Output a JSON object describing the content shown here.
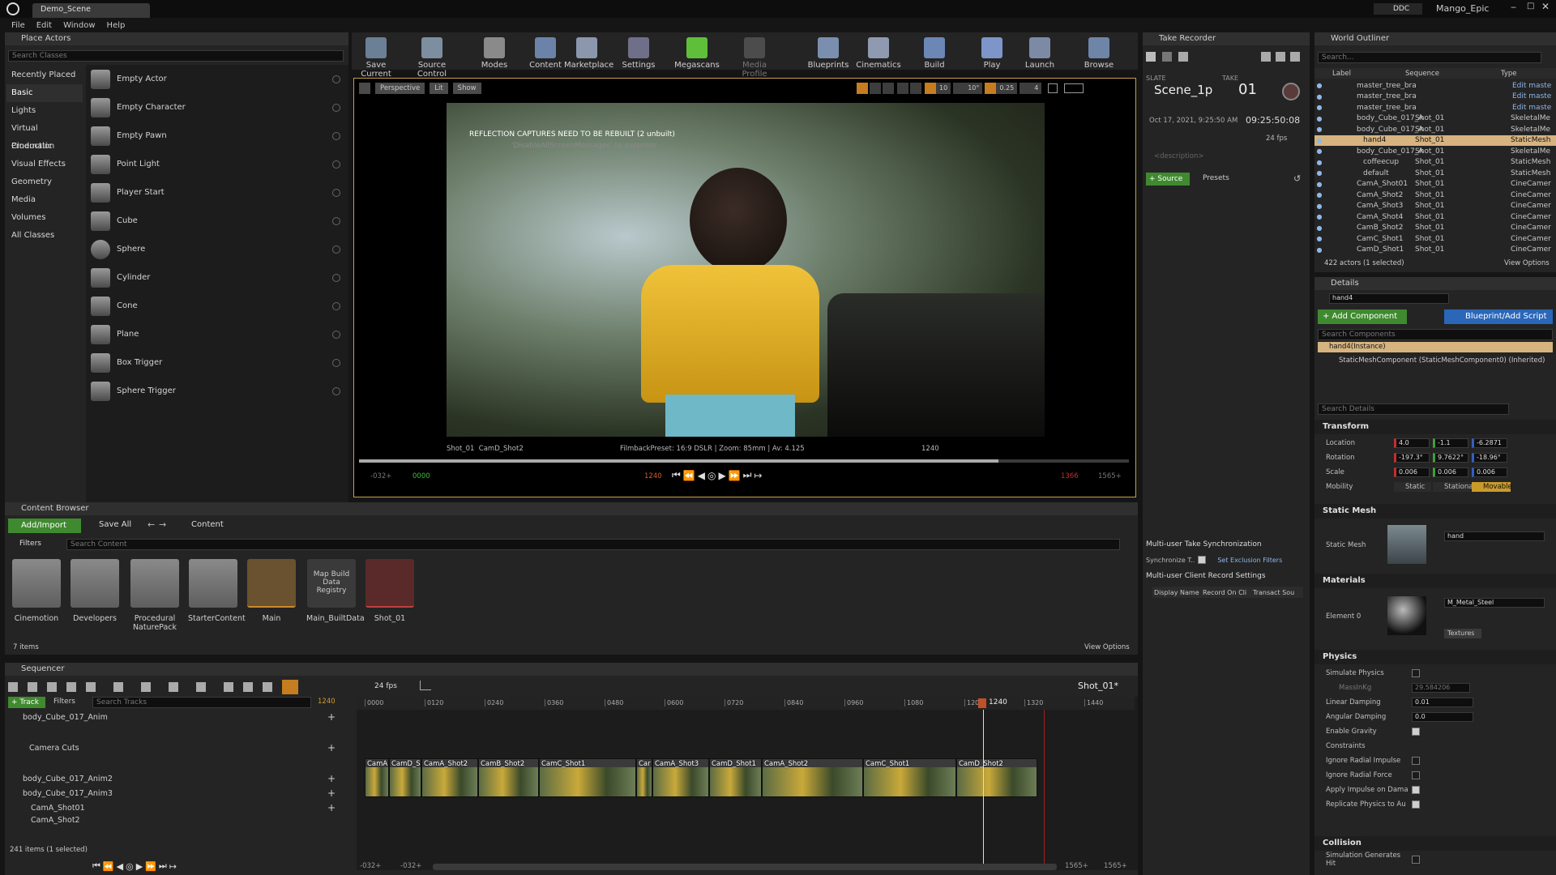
{
  "window": {
    "tab_label": "Demo_Scene",
    "menus": [
      "File",
      "Edit",
      "Window",
      "Help"
    ],
    "source_control_badge": "DDC",
    "project_name": "Mango_Epic"
  },
  "place_actors": {
    "title": "Place Actors",
    "search_placeholder": "Search Classes",
    "categories": [
      "Recently Placed",
      "Basic",
      "Lights",
      "Virtual Production",
      "Cinematic",
      "Visual Effects",
      "Geometry",
      "Media",
      "Volumes",
      "All Classes"
    ],
    "selected_category": "Basic",
    "actors": [
      "Empty Actor",
      "Empty Character",
      "Empty Pawn",
      "Point Light",
      "Player Start",
      "Cube",
      "Sphere",
      "Cylinder",
      "Cone",
      "Plane",
      "Box Trigger",
      "Sphere Trigger"
    ]
  },
  "toolbar": {
    "buttons": [
      "Save Current",
      "Source Control",
      "Modes",
      "Content",
      "Marketplace",
      "Settings",
      "Megascans",
      "Media Profile",
      "Blueprints",
      "Cinematics",
      "Build",
      "Play",
      "Launch",
      "Browse"
    ]
  },
  "viewport": {
    "perspective_label": "Perspective",
    "lit_label": "Lit",
    "show_label": "Show",
    "grid_snap": "10",
    "rot_snap": "10°",
    "scale_snap": "0.25",
    "camera_speed": "4",
    "warning": "REFLECTION CAPTURES NEED TO BE REBUILT (2 unbuilt)",
    "warning_sub": "'DisableAllScreenMessages' to suppress",
    "shot_label": "Shot_01  CamD_Shot2",
    "filmback": "FilmbackPreset: 16:9 DSLR | Zoom: 85mm | Av: 4.125",
    "frame_label": "1240",
    "transport": {
      "start": "-032+",
      "in": "0000",
      "current": "1240",
      "out": "1366",
      "end": "1565+"
    }
  },
  "take_recorder": {
    "title": "Take Recorder",
    "slate_label": "SLATE",
    "slate_value": "Scene_1p",
    "take_label": "TAKE",
    "take_value": "01",
    "date": "Oct 17, 2021, 9:25:50 AM",
    "timecode": "09:25:50:08",
    "fps": "24 fps",
    "description_placeholder": "<description>",
    "source_button": "+ Source",
    "presets_button": "Presets",
    "multiuser_sync": "Multi-user Take Synchronization",
    "synchronize_label": "Synchronize T..",
    "exclusion_filters": "Set Exclusion Filters",
    "client_record": "Multi-user Client Record Settings",
    "columns": [
      "Display Name",
      "Record On Cli",
      "Transact Sou"
    ]
  },
  "world_outliner": {
    "title": "World Outliner",
    "search_placeholder": "Search...",
    "columns": [
      "Label",
      "Sequence",
      "Type"
    ],
    "rows": [
      {
        "label": "master_tree_bra",
        "sequence": "",
        "type": "Edit maste"
      },
      {
        "label": "master_tree_bra",
        "sequence": "",
        "type": "Edit maste"
      },
      {
        "label": "master_tree_bra",
        "sequence": "",
        "type": "Edit maste"
      },
      {
        "label": "body_Cube_017_A",
        "sequence": "Shot_01",
        "type": "SkeletalMe"
      },
      {
        "label": "body_Cube_017_A",
        "sequence": "Shot_01",
        "type": "SkeletalMe"
      },
      {
        "label": "hand4",
        "sequence": "Shot_01",
        "type": "StaticMesh",
        "selected": true
      },
      {
        "label": "body_Cube_017_A",
        "sequence": "Shot_01",
        "type": "SkeletalMe"
      },
      {
        "label": "coffeecup",
        "sequence": "Shot_01",
        "type": "StaticMesh"
      },
      {
        "label": "default",
        "sequence": "Shot_01",
        "type": "StaticMesh"
      },
      {
        "label": "CamA_Shot01",
        "sequence": "Shot_01",
        "type": "CineCamer"
      },
      {
        "label": "CamA_Shot2",
        "sequence": "Shot_01",
        "type": "CineCamer"
      },
      {
        "label": "CamA_Shot3",
        "sequence": "Shot_01",
        "type": "CineCamer"
      },
      {
        "label": "CamA_Shot4",
        "sequence": "Shot_01",
        "type": "CineCamer"
      },
      {
        "label": "CamB_Shot2",
        "sequence": "Shot_01",
        "type": "CineCamer"
      },
      {
        "label": "CamC_Shot1",
        "sequence": "Shot_01",
        "type": "CineCamer"
      },
      {
        "label": "CamD_Shot1",
        "sequence": "Shot_01",
        "type": "CineCamer"
      }
    ],
    "actor_count": "422 actors (1 selected)",
    "view_options": "View Options"
  },
  "details": {
    "title": "Details",
    "name_value": "hand4",
    "add_component": "+ Add Component",
    "blueprint_script": "Blueprint/Add Script",
    "search_components": "Search Components",
    "instance_row": "hand4(Instance)",
    "component_row": "StaticMeshComponent (StaticMeshComponent0) (Inherited)",
    "search_details": "Search Details",
    "transform": {
      "header": "Transform",
      "location_label": "Location",
      "rotation_label": "Rotation",
      "scale_label": "Scale",
      "mobility_label": "Mobility",
      "location": [
        "4.0",
        "-1.1",
        "-6.2871"
      ],
      "rotation": [
        "-197.3°",
        "9.7622°",
        "-18.96°"
      ],
      "scale": [
        "0.006",
        "0.006",
        "0.006"
      ],
      "mobility_options": [
        "Static",
        "Stationa",
        "Movable"
      ]
    },
    "static_mesh": {
      "header": "Static Mesh",
      "label": "Static Mesh",
      "value": "hand"
    },
    "materials": {
      "header": "Materials",
      "element_label": "Element 0",
      "value": "M_Metal_Steel",
      "textures": "Textures"
    },
    "physics": {
      "header": "Physics",
      "simulate": "Simulate Physics",
      "mass": "MassInKg",
      "mass_value": "29.584206",
      "linear_damping": "Linear Damping",
      "linear_value": "0.01",
      "angular_damping": "Angular Damping",
      "angular_value": "0.0",
      "gravity": "Enable Gravity",
      "constraints": "Constraints",
      "radial_impulse": "Ignore Radial Impulse",
      "radial_force": "Ignore Radial Force",
      "impulse_damage": "Apply Impulse on Dama",
      "replicate": "Replicate Physics to Au"
    },
    "collision": {
      "header": "Collision",
      "sim_generates": "Simulation Generates Hit"
    }
  },
  "content_browser": {
    "title": "Content Browser",
    "add_import": "Add/Import",
    "save_all": "Save All",
    "path": "Content",
    "filters": "Filters",
    "search_placeholder": "Search Content",
    "items": [
      "Cinemotion",
      "Developers",
      "Procedural NaturePack",
      "StarterContent",
      "Main",
      "Main_BuiltData",
      "Shot_01"
    ],
    "map_build_label": "Map Build Data Registry",
    "item_count": "7 items",
    "view_options": "View Options"
  },
  "sequencer": {
    "title": "Sequencer",
    "fps": "24 fps",
    "sequence_name": "Shot_01*",
    "track_button": "+ Track",
    "filters": "Filters",
    "search_placeholder": "Search Tracks",
    "current_frame": "1240",
    "tracks": [
      "body_Cube_017_Anim",
      "Camera Cuts",
      "body_Cube_017_Anim2",
      "body_Cube_017_Anim3",
      "CamA_Shot01",
      "CamA_Shot2"
    ],
    "item_count": "241 items (1 selected)",
    "ruler": [
      "0000",
      "0120",
      "0240",
      "0360",
      "0480",
      "0600",
      "0720",
      "0840",
      "0960",
      "1080",
      "1200",
      "1320",
      "1440"
    ],
    "playhead": "1240",
    "clips": [
      {
        "label": "CamA",
        "start": 0,
        "end": 30
      },
      {
        "label": "CamD_S",
        "start": 30,
        "end": 70
      },
      {
        "label": "CamA_Shot2",
        "start": 70,
        "end": 140
      },
      {
        "label": "CamB_Shot2",
        "start": 140,
        "end": 215
      },
      {
        "label": "CamC_Shot1",
        "start": 215,
        "end": 335
      },
      {
        "label": "Car",
        "start": 335,
        "end": 355
      },
      {
        "label": "CamA_Shot3",
        "start": 355,
        "end": 425
      },
      {
        "label": "CamD_Shot1",
        "start": 425,
        "end": 490
      },
      {
        "label": "CamA_Shot2",
        "start": 490,
        "end": 615
      },
      {
        "label": "CamC_Shot1",
        "start": 615,
        "end": 730
      },
      {
        "label": "CamD_Shot2",
        "start": 730,
        "end": 830
      }
    ],
    "bottom": {
      "start": "-032+",
      "in": "-032+",
      "out": "1565+",
      "end": "1565+"
    }
  }
}
